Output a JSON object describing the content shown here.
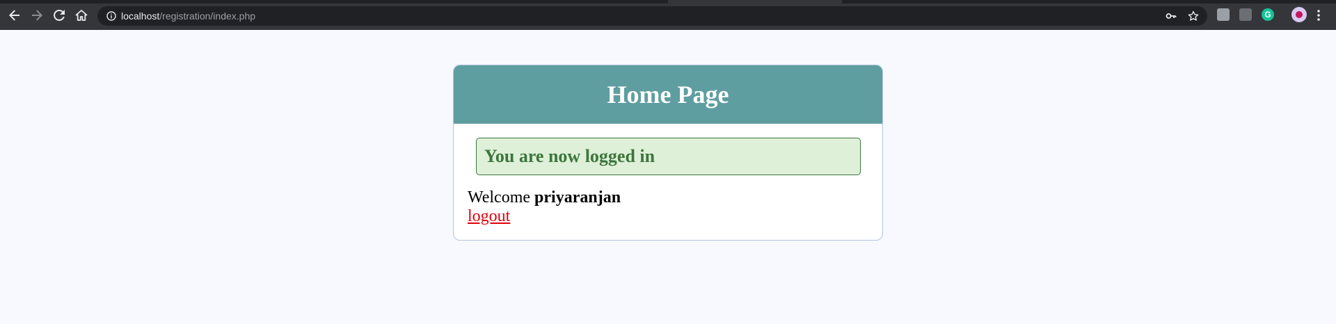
{
  "browser": {
    "url_host": "localhost",
    "url_path": "/registration/index.php"
  },
  "page": {
    "title": "Home Page",
    "success_message": "You are now logged in",
    "welcome_prefix": "Welcome",
    "username": "priyaranjan",
    "logout_label": "logout"
  },
  "colors": {
    "header_bg": "#5f9ea0",
    "success_bg": "#dff0d8",
    "success_text": "#3c763d",
    "logout_link": "#e0000b"
  }
}
